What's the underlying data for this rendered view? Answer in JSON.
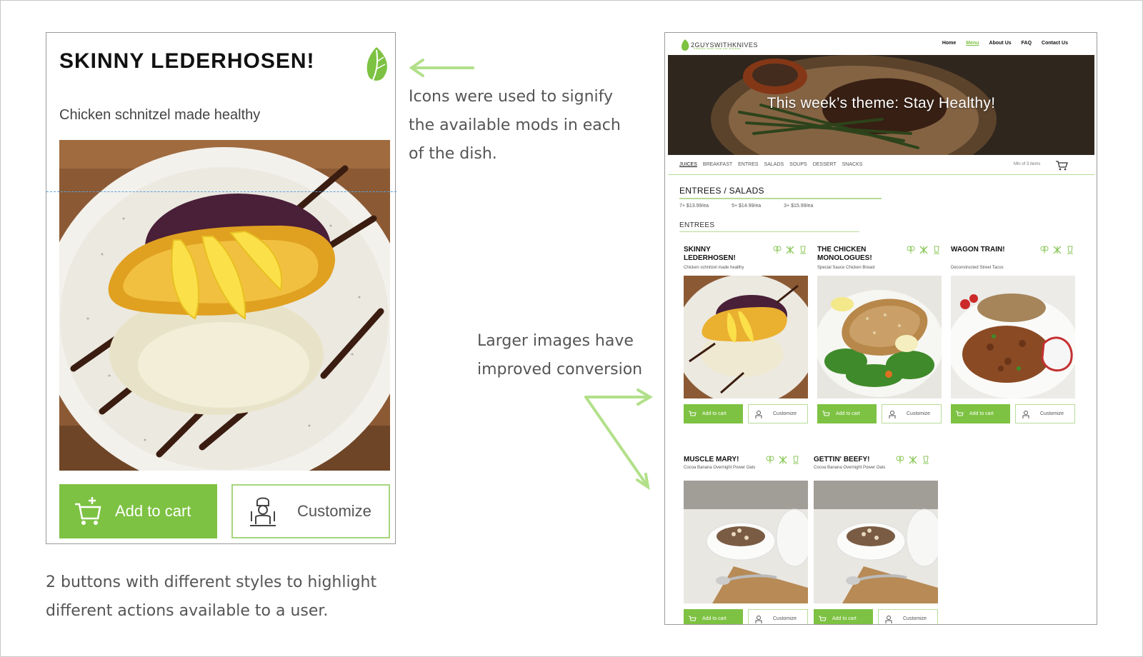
{
  "big_card": {
    "title": "SKINNY LEDERHOSEN!",
    "subtitle": "Chicken schnitzel made healthy",
    "add_label": "Add to cart",
    "customize_label": "Customize"
  },
  "notes": {
    "icons": "Icons were used to signify the available mods in each of the dish.",
    "images": "Larger images have improved conversion",
    "buttons": "2 buttons with different styles to highlight different actions available to a user."
  },
  "site": {
    "logo_text": "2GUYSWITHKNIVES",
    "logo_sub": "healthy food from our kitchen",
    "nav": [
      "Home",
      "Menu",
      "About Us",
      "FAQ",
      "Contact Us"
    ],
    "nav_active": "Menu",
    "hero_text": "This week’s theme: Stay Healthy!",
    "categories": [
      "JUICES",
      "BREAKFAST",
      "ENTRES",
      "SALADS",
      "SOUPS",
      "DESSERT",
      "SNACKS"
    ],
    "min_items": "Min of 3 items",
    "section_title": "ENTREES / SALADS",
    "prices": [
      "7+ $13.99/ea",
      "5+ $14.99/ea",
      "3+ $15.99/ea"
    ],
    "subsection_title": "ENTREES",
    "cards": [
      {
        "title": "SKINNY LEDERHOSEN!",
        "desc": "Chicken schnitzel made healthy",
        "add": "Add to cart",
        "customize": "Customize"
      },
      {
        "title": "THE CHICKEN MONOLOGUES!",
        "desc": "Special Sauce Chicken Breast",
        "add": "Add to cart",
        "customize": "Customize"
      },
      {
        "title": "WAGON TRAIN!",
        "desc": "Deconstructed Street Tacos",
        "add": "Add to cart",
        "customize": "Customize"
      },
      {
        "title": "MUSCLE MARY!",
        "desc": "Cocoa Banana Overnight Power Oats",
        "add": "Add to cart",
        "customize": "Customize"
      },
      {
        "title": "GETTIN' BEEFY!",
        "desc": "Cocoa Banana Overnight Power Oats",
        "add": "Add to cart",
        "customize": "Customize"
      }
    ]
  },
  "colors": {
    "accent": "#7dc242",
    "accent_light": "#a6d67c",
    "arrow": "#b2e08a"
  },
  "icons": {
    "leaf": "leaf-icon",
    "cart": "cart-icon",
    "chef": "chef-icon",
    "mods": [
      "broccoli-icon",
      "no-utensils-icon",
      "glass-icon"
    ]
  }
}
